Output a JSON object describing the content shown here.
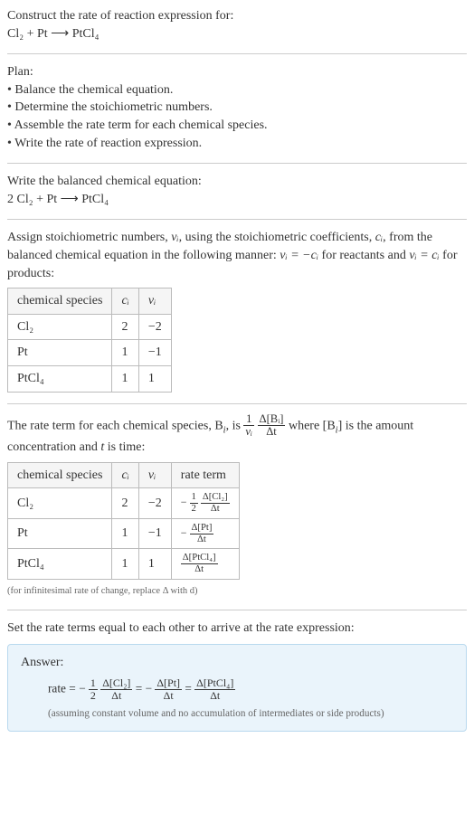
{
  "intro": {
    "prompt": "Construct the rate of reaction expression for:",
    "equation": "Cl₂ + Pt ⟶ PtCl₄"
  },
  "plan": {
    "heading": "Plan:",
    "items": [
      "Balance the chemical equation.",
      "Determine the stoichiometric numbers.",
      "Assemble the rate term for each chemical species.",
      "Write the rate of reaction expression."
    ]
  },
  "balanced": {
    "heading": "Write the balanced chemical equation:",
    "equation": "2 Cl₂ + Pt ⟶ PtCl₄"
  },
  "assign_text_1": "Assign stoichiometric numbers, ",
  "assign_text_2": ", using the stoichiometric coefficients, ",
  "assign_text_3": ", from the balanced chemical equation in the following manner: ",
  "assign_text_4": " for reactants and ",
  "assign_text_5": " for products:",
  "nu_i": "νᵢ",
  "c_i": "cᵢ",
  "eq_react": "νᵢ = −cᵢ",
  "eq_prod": "νᵢ = cᵢ",
  "table1": {
    "headers": [
      "chemical species",
      "cᵢ",
      "νᵢ"
    ],
    "rows": [
      [
        "Cl₂",
        "2",
        "−2"
      ],
      [
        "Pt",
        "1",
        "−1"
      ],
      [
        "PtCl₄",
        "1",
        "1"
      ]
    ]
  },
  "rate_term_text_1": "The rate term for each chemical species, B",
  "rate_term_text_2": ", is ",
  "rate_term_text_3": " where [B",
  "rate_term_text_4": "] is the amount concentration and ",
  "rate_term_text_5": " is time:",
  "i_sub": "i",
  "t_var": "t",
  "frac1": {
    "num": "1",
    "den": "νᵢ"
  },
  "frac2": {
    "num": "Δ[Bᵢ]",
    "den": "Δt"
  },
  "table2": {
    "headers": [
      "chemical species",
      "cᵢ",
      "νᵢ",
      "rate term"
    ],
    "rows": [
      {
        "sp": "Cl₂",
        "c": "2",
        "v": "−2",
        "rt_prefix": "−",
        "rt_f1n": "1",
        "rt_f1d": "2",
        "rt_f2n": "Δ[Cl₂]",
        "rt_f2d": "Δt"
      },
      {
        "sp": "Pt",
        "c": "1",
        "v": "−1",
        "rt_prefix": "−",
        "rt_f1n": "",
        "rt_f1d": "",
        "rt_f2n": "Δ[Pt]",
        "rt_f2d": "Δt"
      },
      {
        "sp": "PtCl₄",
        "c": "1",
        "v": "1",
        "rt_prefix": "",
        "rt_f1n": "",
        "rt_f1d": "",
        "rt_f2n": "Δ[PtCl₄]",
        "rt_f2d": "Δt"
      }
    ]
  },
  "infinitesimal_note": "(for infinitesimal rate of change, replace Δ with d)",
  "set_equal": "Set the rate terms equal to each other to arrive at the rate expression:",
  "answer": {
    "label": "Answer:",
    "prefix": "rate = −",
    "f1": {
      "num": "1",
      "den": "2"
    },
    "f2": {
      "num": "Δ[Cl₂]",
      "den": "Δt"
    },
    "eq1": " = −",
    "f3": {
      "num": "Δ[Pt]",
      "den": "Δt"
    },
    "eq2": " = ",
    "f4": {
      "num": "Δ[PtCl₄]",
      "den": "Δt"
    },
    "note": "(assuming constant volume and no accumulation of intermediates or side products)"
  }
}
